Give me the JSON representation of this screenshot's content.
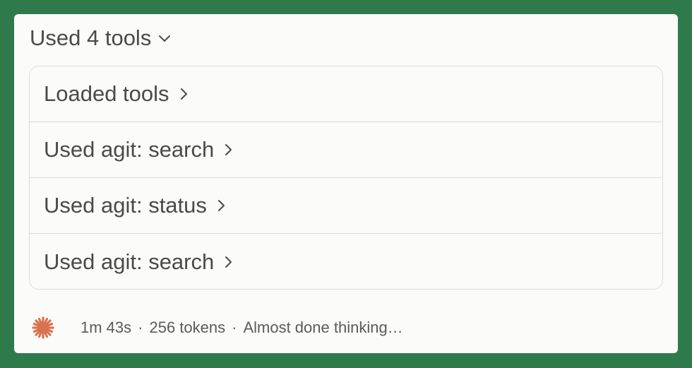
{
  "header": {
    "label": "Used 4 tools",
    "icon": "chevron-down-icon"
  },
  "tools": [
    {
      "label": "Loaded tools",
      "icon": "chevron-right-icon"
    },
    {
      "label": "Used agit: search",
      "icon": "chevron-right-icon"
    },
    {
      "label": "Used agit: status",
      "icon": "chevron-right-icon"
    },
    {
      "label": "Used agit: search",
      "icon": "chevron-right-icon"
    }
  ],
  "status": {
    "icon": "sparkle-icon",
    "elapsed": "1m 43s",
    "separator": "·",
    "tokens": "256 tokens",
    "message": "Almost done thinking…"
  },
  "colors": {
    "background": "#2e7a4a",
    "card": "#fbfbf9",
    "text": "#4a4a48",
    "border": "#dcdcd8",
    "accent": "#d9704f"
  }
}
